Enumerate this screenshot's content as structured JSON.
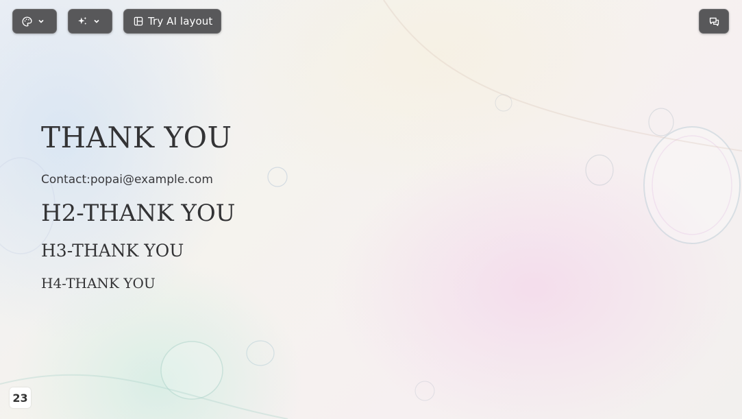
{
  "toolbar": {
    "theme_button": {
      "icon": "palette-icon",
      "dropdown_icon": "chevron-down-icon"
    },
    "magic_button": {
      "icon": "sparkle-icon",
      "dropdown_icon": "chevron-down-icon"
    },
    "layout_button": {
      "icon": "layout-icon",
      "label": "Try AI layout"
    },
    "comment_button": {
      "icon": "comments-icon"
    }
  },
  "slide": {
    "title": "THANK YOU",
    "contact": "Contact:popai@example.com",
    "h2": "H2-THANK YOU",
    "h3": "H3-THANK YOU",
    "h4": "H4-THANK YOU",
    "page_number": "23"
  },
  "colors": {
    "toolbar_bg": "#58585a",
    "text": "#333335",
    "accent_pink": "#f2cee8",
    "accent_blue": "#cee0f4"
  }
}
